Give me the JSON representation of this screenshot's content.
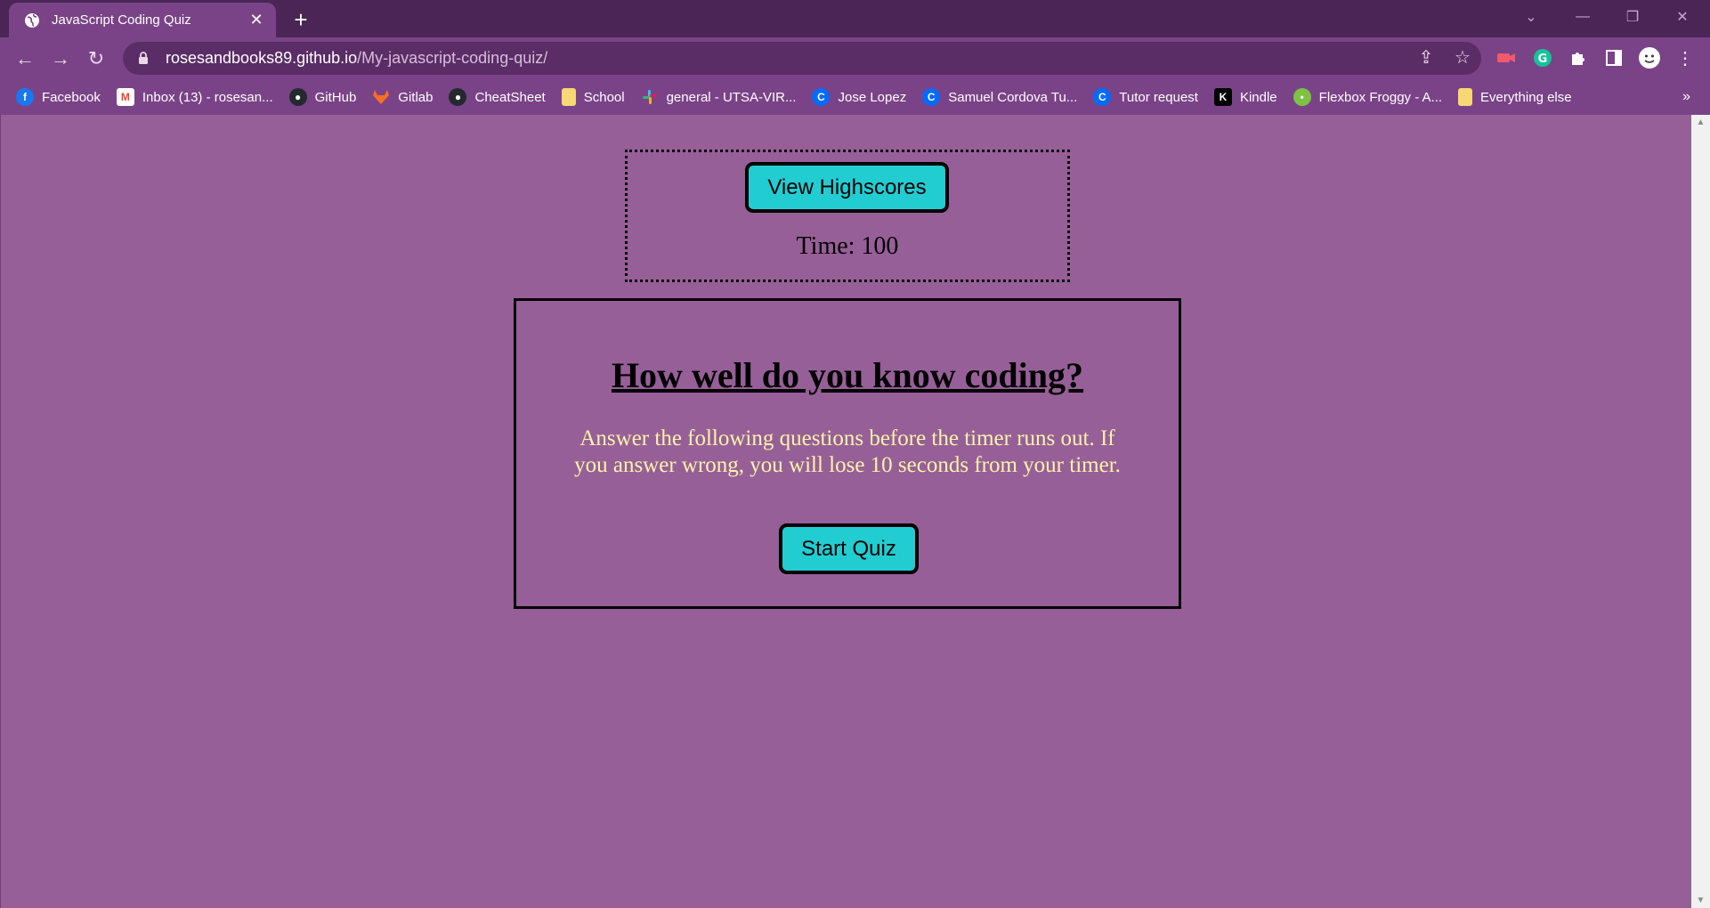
{
  "browser": {
    "tab_title": "JavaScript Coding Quiz",
    "url_host": "rosesandbooks89.github.io",
    "url_path": "/My-javascript-coding-quiz/",
    "chrome_color": "#7a4387",
    "tabstrip_color": "#4a2555"
  },
  "bookmarks": [
    {
      "label": "Facebook",
      "icon": "facebook-icon",
      "color": "#1877f2"
    },
    {
      "label": "Inbox (13) - rosesan...",
      "icon": "gmail-icon",
      "color": "#ea4335"
    },
    {
      "label": "GitHub",
      "icon": "github-icon",
      "color": "#24292e"
    },
    {
      "label": "Gitlab",
      "icon": "gitlab-icon",
      "color": "#fc6d26"
    },
    {
      "label": "CheatSheet",
      "icon": "github-icon",
      "color": "#24292e"
    },
    {
      "label": "School",
      "icon": "folder-icon",
      "color": "#f8d775"
    },
    {
      "label": "general - UTSA-VIR...",
      "icon": "slack-icon",
      "color": "#e01e5a"
    },
    {
      "label": "Jose Lopez",
      "icon": "calendly-icon",
      "color": "#006bff"
    },
    {
      "label": "Samuel Cordova Tu...",
      "icon": "calendly-icon",
      "color": "#006bff"
    },
    {
      "label": "Tutor request",
      "icon": "calendly-icon",
      "color": "#006bff"
    },
    {
      "label": "Kindle",
      "icon": "kindle-icon",
      "color": "#000000"
    },
    {
      "label": "Flexbox Froggy - A...",
      "icon": "frog-icon",
      "color": "#7dc242"
    },
    {
      "label": "Everything else",
      "icon": "folder-icon",
      "color": "#f8d775"
    }
  ],
  "page": {
    "background": "#975f98",
    "highscores_label": "View Highscores",
    "timer_text": "Time: 100",
    "quiz_title": "How well do you know coding?",
    "quiz_description": "Answer the following questions before the timer runs out. If you answer wrong, you will lose 10 seconds from your timer.",
    "start_label": "Start Quiz",
    "button_color": "#22cdd2",
    "description_color": "#fbf4a9"
  }
}
